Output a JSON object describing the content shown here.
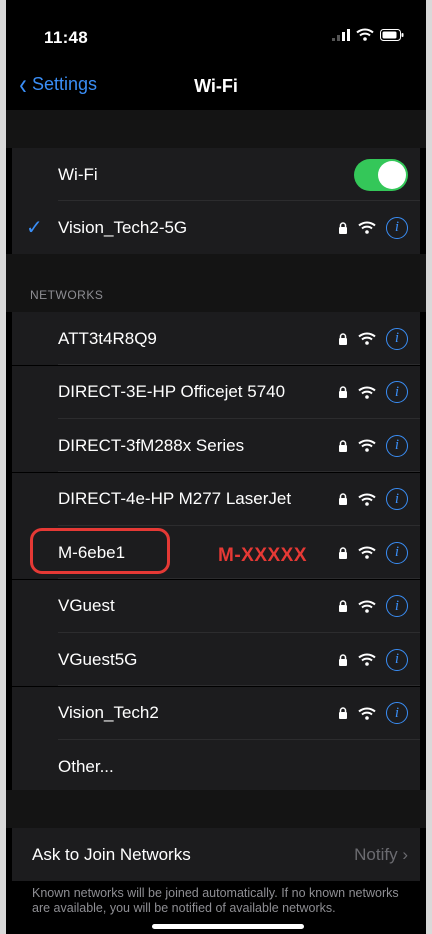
{
  "status_bar": {
    "time": "11:48"
  },
  "nav": {
    "back_label": "Settings",
    "title": "Wi-Fi"
  },
  "wifi_toggle": {
    "label": "Wi-Fi",
    "on": true
  },
  "connected": {
    "name": "Vision_Tech2-5G"
  },
  "networks_header": "NETWORKS",
  "networks": [
    {
      "name": "ATT3t4R8Q9"
    },
    {
      "name": "DIRECT-3E-HP Officejet 5740"
    },
    {
      "name": "DIRECT-3fM288x Series"
    },
    {
      "name": "DIRECT-4e-HP M277 LaserJet"
    },
    {
      "name": "M-6ebe1"
    },
    {
      "name": "VGuest"
    },
    {
      "name": "VGuest5G"
    },
    {
      "name": "Vision_Tech2"
    },
    {
      "name": "Other..."
    }
  ],
  "annotation": {
    "text": "M-XXXXX",
    "color": "#e53935"
  },
  "ask_to_join": {
    "label": "Ask to Join Networks",
    "value": "Notify"
  },
  "footer": "Known networks will be joined automatically. If no known networks are available, you will be notified of available networks.",
  "colors": {
    "accent": "#3a8ef6",
    "toggle_on": "#34c759",
    "annotation": "#e53935"
  }
}
